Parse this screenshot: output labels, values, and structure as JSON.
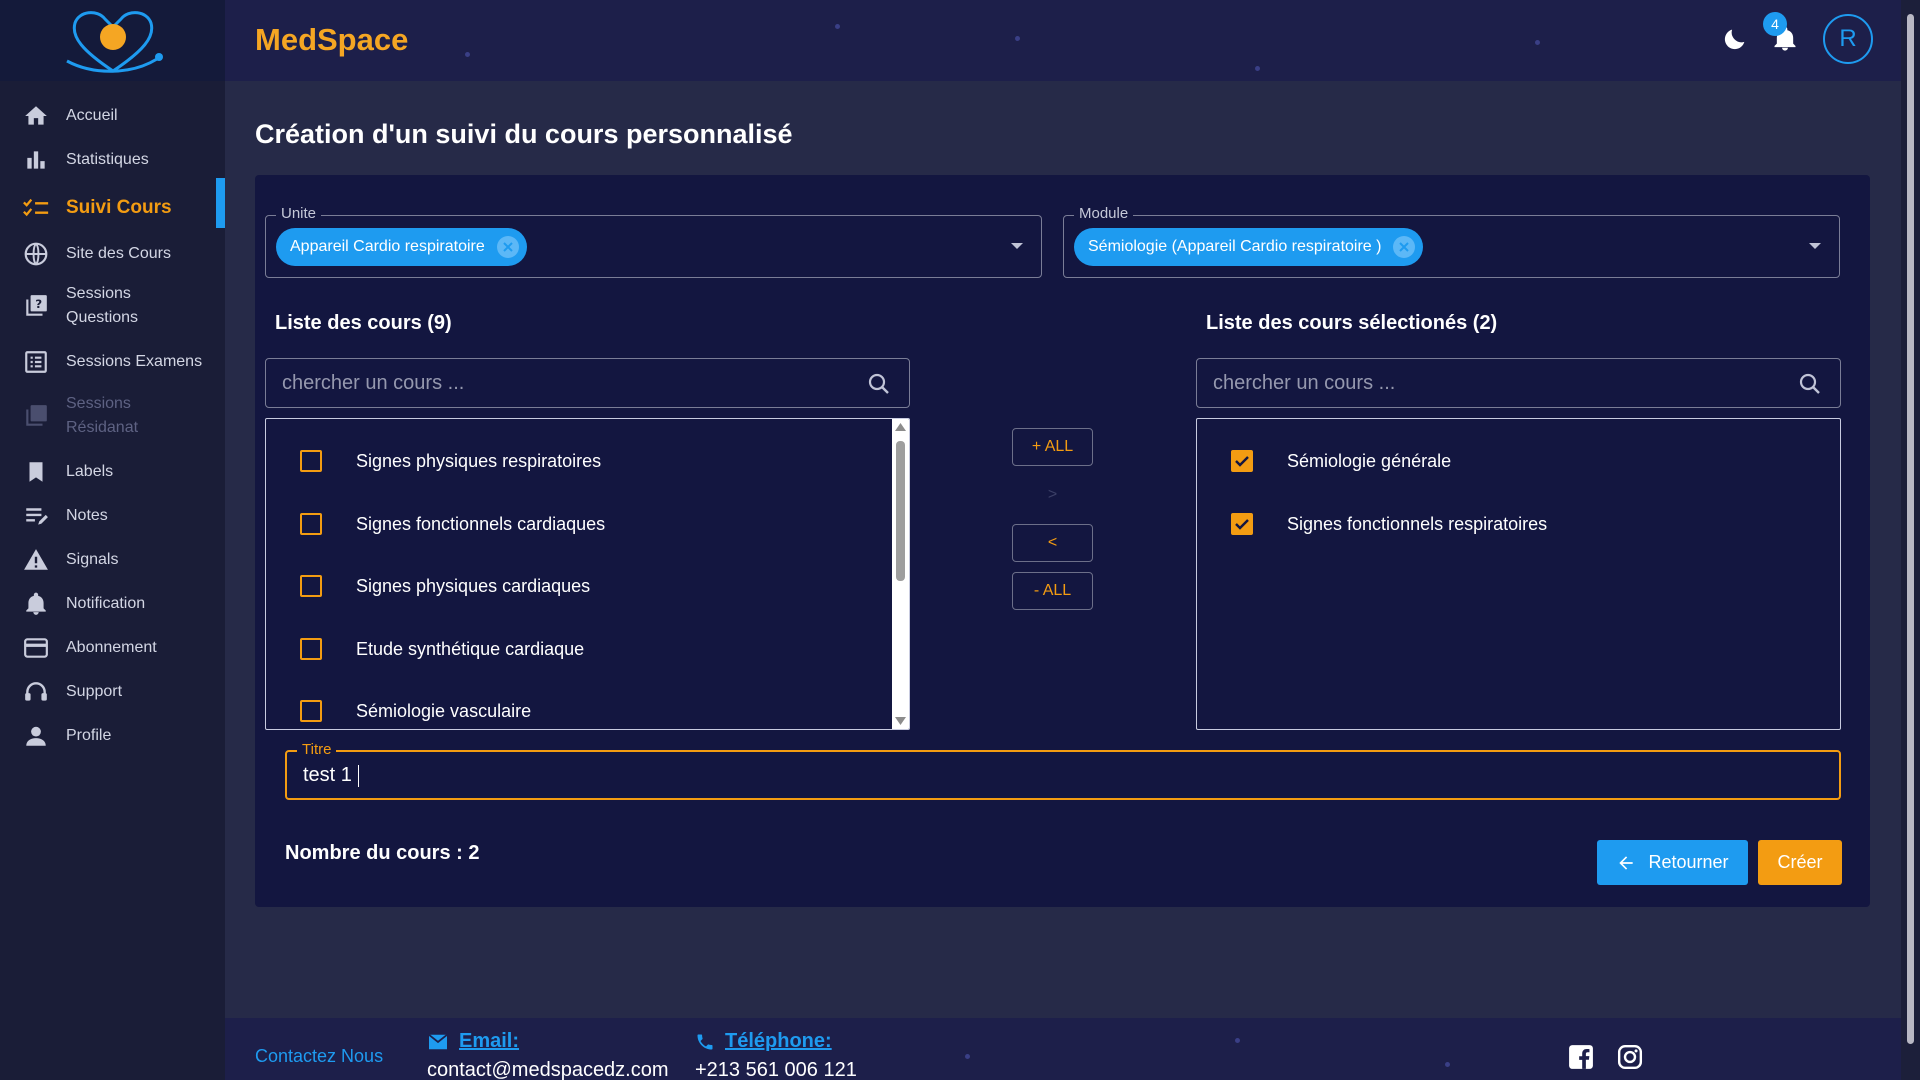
{
  "app": {
    "brand": "MedSpace"
  },
  "sidebar": {
    "items": [
      {
        "label": "Accueil",
        "icon": "home-icon"
      },
      {
        "label": "Statistiques",
        "icon": "bar-chart-icon"
      },
      {
        "label": "Suivi Cours",
        "icon": "checklist-icon"
      },
      {
        "label": "Site des Cours",
        "icon": "globe-icon"
      },
      {
        "label": "Sessions Questions",
        "icon": "quiz-icon"
      },
      {
        "label": "Sessions Examens",
        "icon": "list-icon"
      },
      {
        "label": "Sessions Résidanat",
        "icon": "document-icon"
      },
      {
        "label": "Labels",
        "icon": "bookmark-icon"
      },
      {
        "label": "Notes",
        "icon": "notes-icon"
      },
      {
        "label": "Signals",
        "icon": "warning-icon"
      },
      {
        "label": "Notification",
        "icon": "bell-icon"
      },
      {
        "label": "Abonnement",
        "icon": "credit-card-icon"
      },
      {
        "label": "Support",
        "icon": "headset-icon"
      },
      {
        "label": "Profile",
        "icon": "person-icon"
      }
    ]
  },
  "header": {
    "notification_count": "4",
    "avatar_letter": "R"
  },
  "page": {
    "title": "Création d'un suivi du cours personnalisé"
  },
  "unite": {
    "label": "Unite",
    "value": "Appareil Cardio respiratoire"
  },
  "module": {
    "label": "Module",
    "value": "Sémiologie (Appareil Cardio respiratoire )"
  },
  "available": {
    "title": "Liste des cours (9)",
    "search_placeholder": "chercher un cours ...",
    "items": [
      {
        "label": "Signes physiques respiratoires",
        "checked": false
      },
      {
        "label": "Signes fonctionnels cardiaques",
        "checked": false
      },
      {
        "label": "Signes physiques cardiaques",
        "checked": false
      },
      {
        "label": "Etude synthétique cardiaque",
        "checked": false
      },
      {
        "label": "Sémiologie vasculaire",
        "checked": false
      }
    ]
  },
  "selected": {
    "title": "Liste des cours sélectionés (2)",
    "search_placeholder": "chercher un cours ...",
    "items": [
      {
        "label": "Sémiologie générale",
        "checked": true
      },
      {
        "label": "Signes fonctionnels respiratoires",
        "checked": true
      }
    ]
  },
  "transfer": {
    "add_all": "+ ALL",
    "add": ">",
    "remove": "<",
    "remove_all": "- ALL"
  },
  "titre": {
    "label": "Titre",
    "value": "test 1"
  },
  "count": {
    "text": "Nombre du cours : 2"
  },
  "actions": {
    "back": "Retourner",
    "create": "Créer"
  },
  "footer": {
    "contact": "Contactez Nous",
    "email_label": "Email:",
    "email_value": "contact@medspacedz.com",
    "phone_label": "Téléphone:",
    "phone_value": "+213 561 006 121"
  },
  "colors": {
    "accent": "#f39c12",
    "primary": "#1e9bf0",
    "background": "#262a48"
  }
}
